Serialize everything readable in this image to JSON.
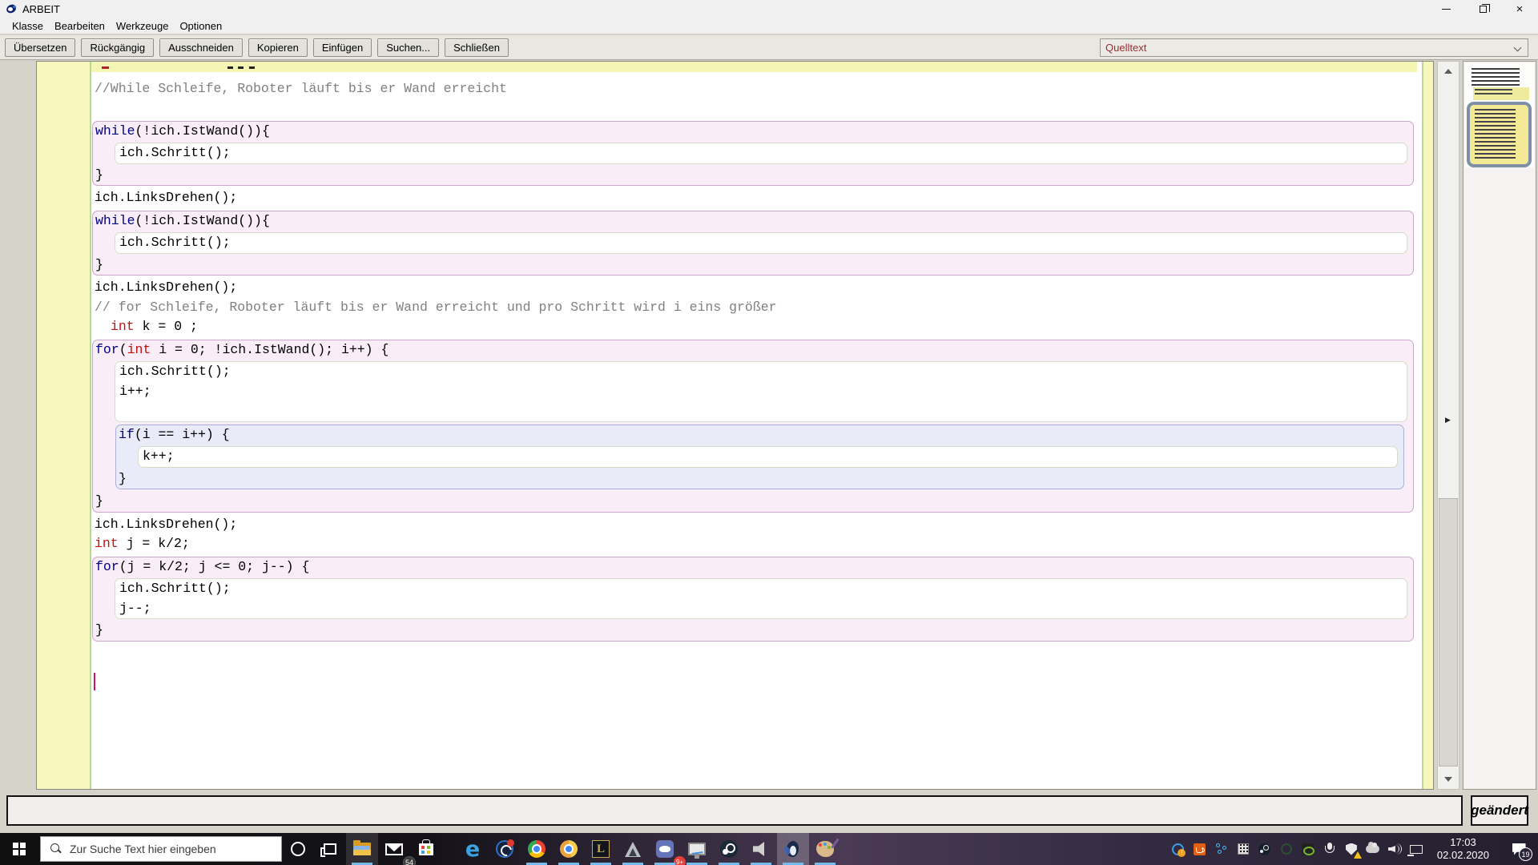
{
  "window": {
    "title": "ARBEIT"
  },
  "menu": {
    "items": [
      "Klasse",
      "Bearbeiten",
      "Werkzeuge",
      "Optionen"
    ]
  },
  "toolbar": {
    "buttons": [
      "Übersetzen",
      "Rückgängig",
      "Ausschneiden",
      "Kopieren",
      "Einfügen",
      "Suchen...",
      "Schließen"
    ],
    "view_select_value": "Quelltext"
  },
  "colors": {
    "keyword": "#000080",
    "type_keyword": "#c01010",
    "comment": "#808080",
    "loop_block_fill": "#f9eef8",
    "loop_block_border": "#c9a6ca",
    "if_block_fill": "#e9ebf8",
    "if_block_border": "#a9afd6",
    "caret": "#d4145a",
    "view_select_text": "#9b2d30"
  },
  "editor": {
    "code": [
      {
        "kind": "comment",
        "text": "//While Schleife, Roboter läuft bis er Wand erreicht"
      },
      {
        "kind": "gap"
      },
      {
        "kind": "block",
        "style": "loop",
        "header": [
          [
            "kw",
            "while"
          ],
          [
            "pl",
            "(!ich.IstWand()){"
          ]
        ],
        "children": [
          {
            "kind": "stmtbox",
            "lines": [
              [
                [
                  "pl",
                  "ich.Schritt();"
                ]
              ]
            ]
          }
        ],
        "close": "}"
      },
      {
        "kind": "line",
        "segs": [
          [
            "pl",
            "ich.LinksDrehen();"
          ]
        ]
      },
      {
        "kind": "block",
        "style": "loop",
        "header": [
          [
            "kw",
            "while"
          ],
          [
            "pl",
            "(!ich.IstWand()){"
          ]
        ],
        "children": [
          {
            "kind": "stmtbox",
            "lines": [
              [
                [
                  "pl",
                  "ich.Schritt();"
                ]
              ]
            ]
          }
        ],
        "close": "}"
      },
      {
        "kind": "line",
        "segs": [
          [
            "pl",
            "ich.LinksDrehen();"
          ]
        ]
      },
      {
        "kind": "comment",
        "text": "// for Schleife, Roboter läuft bis er Wand erreicht und pro Schritt wird i eins größer"
      },
      {
        "kind": "line",
        "indent": 2,
        "segs": [
          [
            "ty",
            "int"
          ],
          [
            "pl",
            " k = 0 ;"
          ]
        ]
      },
      {
        "kind": "block",
        "style": "loop",
        "header": [
          [
            "kw",
            "for"
          ],
          [
            "pl",
            "("
          ],
          [
            "ty",
            "int"
          ],
          [
            "pl",
            " i = 0; !ich.IstWand(); i++) {"
          ]
        ],
        "children": [
          {
            "kind": "stmtbox",
            "lines": [
              [
                [
                  "pl",
                  "ich.Schritt();"
                ]
              ],
              [
                [
                  "pl",
                  "i++;"
                ]
              ],
              [
                [
                  "pl",
                  " "
                ]
              ]
            ]
          },
          {
            "kind": "block",
            "style": "cond",
            "header": [
              [
                "kw",
                "if"
              ],
              [
                "pl",
                "(i == i++) {"
              ]
            ],
            "children": [
              {
                "kind": "stmtbox",
                "lines": [
                  [
                    [
                      "pl",
                      "k++;"
                    ]
                  ]
                ]
              }
            ],
            "close": "}"
          }
        ],
        "close": "}"
      },
      {
        "kind": "line",
        "segs": [
          [
            "pl",
            "ich.LinksDrehen();"
          ]
        ]
      },
      {
        "kind": "line",
        "segs": [
          [
            "ty",
            "int"
          ],
          [
            "pl",
            " j = k/2;"
          ]
        ]
      },
      {
        "kind": "block",
        "style": "loop",
        "header": [
          [
            "kw",
            "for"
          ],
          [
            "pl",
            "(j = k/2; j <= 0; j--) {"
          ]
        ],
        "children": [
          {
            "kind": "stmtbox",
            "lines": [
              [
                [
                  "pl",
                  "ich.Schritt();"
                ]
              ],
              [
                [
                  "pl",
                  "j--;"
                ]
              ]
            ]
          }
        ],
        "close": "}"
      }
    ]
  },
  "status": {
    "modified_label": "geändert"
  },
  "taskbar": {
    "search_placeholder": "Zur Suche Text hier eingeben",
    "mail_badge": "54",
    "discord_badge": "9+",
    "clock_time": "17:03",
    "clock_date": "02.02.2020",
    "notification_count": "19"
  }
}
